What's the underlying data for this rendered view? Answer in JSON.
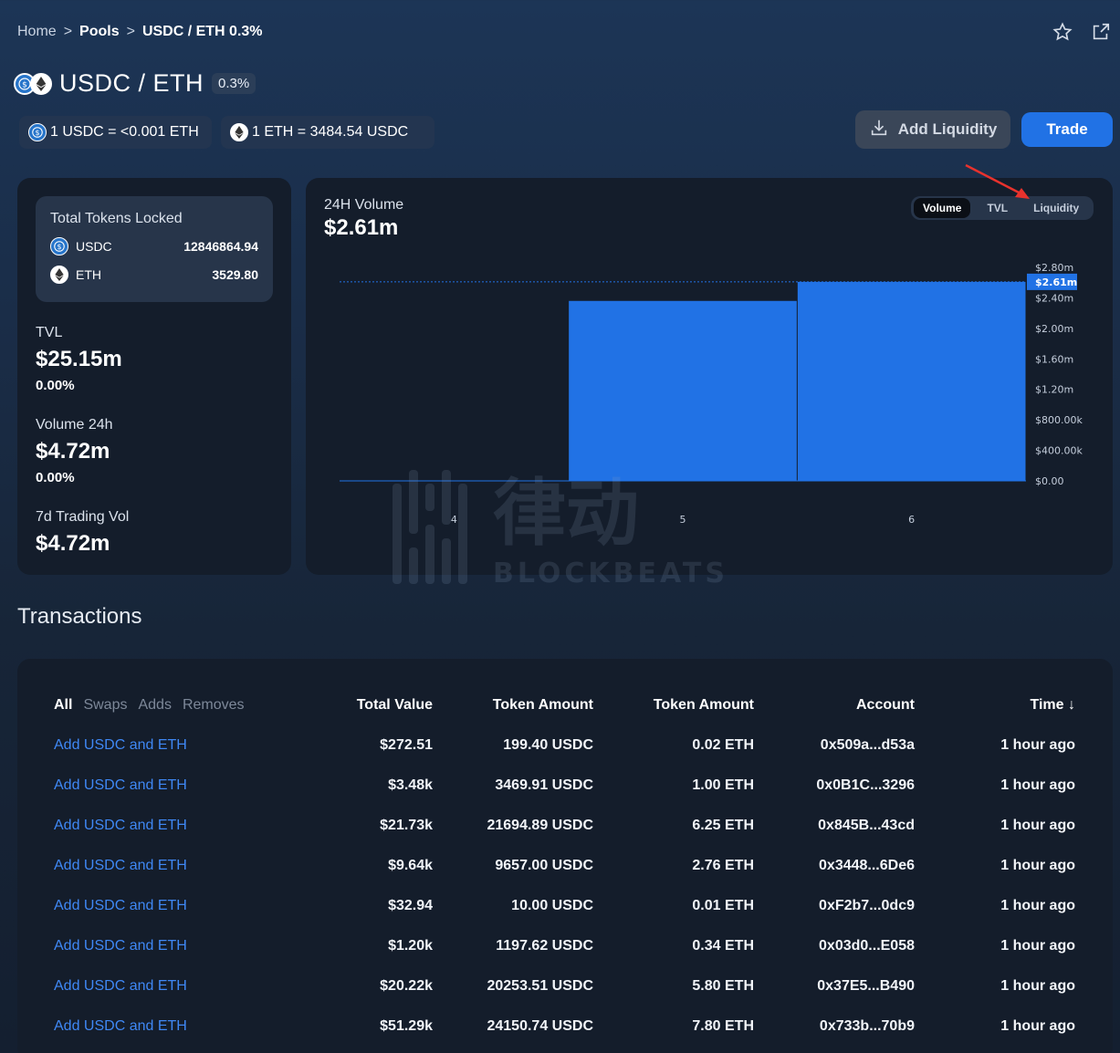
{
  "breadcrumb": {
    "home": "Home",
    "sep1": ">",
    "pools": "Pools",
    "sep2": ">",
    "current": "USDC / ETH 0.3%"
  },
  "pool": {
    "title": "USDC / ETH",
    "fee": "0.3%"
  },
  "prices": {
    "usdc_eth": "1 USDC = <0.001 ETH",
    "eth_usdc": "1 ETH = 3484.54 USDC"
  },
  "actions": {
    "add_liquidity": "Add Liquidity",
    "trade": "Trade"
  },
  "locked": {
    "title": "Total Tokens Locked",
    "tokens": [
      {
        "symbol": "USDC",
        "amount": "12846864.94"
      },
      {
        "symbol": "ETH",
        "amount": "3529.80"
      }
    ]
  },
  "stats": {
    "tvl": {
      "label": "TVL",
      "value": "$25.15m",
      "change": "0.00%"
    },
    "volume24h": {
      "label": "Volume 24h",
      "value": "$4.72m",
      "change": "0.00%"
    },
    "trading7d": {
      "label": "7d Trading Vol",
      "value": "$4.72m"
    }
  },
  "chart": {
    "title": "24H Volume",
    "value": "$2.61m",
    "tabs": [
      "Volume",
      "TVL",
      "Liquidity"
    ],
    "active_tab": "Volume"
  },
  "chart_data": {
    "type": "bar",
    "categories": [
      "4",
      "5",
      "6"
    ],
    "values": [
      0,
      2.36,
      2.61
    ],
    "current_label": "$2.61m",
    "ylim": [
      0,
      2.8
    ],
    "yticks": [
      {
        "v": 2.8,
        "label": "$2.80m"
      },
      {
        "v": 2.4,
        "label": "$2.40m"
      },
      {
        "v": 2.0,
        "label": "$2.00m"
      },
      {
        "v": 1.6,
        "label": "$1.60m"
      },
      {
        "v": 1.2,
        "label": "$1.20m"
      },
      {
        "v": 0.8,
        "label": "$800.00k"
      },
      {
        "v": 0.4,
        "label": "$400.00k"
      },
      {
        "v": 0,
        "label": "$0.00"
      }
    ],
    "bar_color": "#2172e5"
  },
  "transactions": {
    "heading": "Transactions",
    "filters": [
      "All",
      "Swaps",
      "Adds",
      "Removes"
    ],
    "columns": [
      "Total Value",
      "Token Amount",
      "Token Amount",
      "Account",
      "Time ↓"
    ],
    "rows": [
      {
        "desc": "Add USDC and ETH",
        "total": "$272.51",
        "amount1": "199.40 USDC",
        "amount2": "0.02 ETH",
        "account": "0x509a...d53a",
        "time": "1 hour ago"
      },
      {
        "desc": "Add USDC and ETH",
        "total": "$3.48k",
        "amount1": "3469.91 USDC",
        "amount2": "1.00 ETH",
        "account": "0x0B1C...3296",
        "time": "1 hour ago"
      },
      {
        "desc": "Add USDC and ETH",
        "total": "$21.73k",
        "amount1": "21694.89 USDC",
        "amount2": "6.25 ETH",
        "account": "0x845B...43cd",
        "time": "1 hour ago"
      },
      {
        "desc": "Add USDC and ETH",
        "total": "$9.64k",
        "amount1": "9657.00 USDC",
        "amount2": "2.76 ETH",
        "account": "0x3448...6De6",
        "time": "1 hour ago"
      },
      {
        "desc": "Add USDC and ETH",
        "total": "$32.94",
        "amount1": "10.00 USDC",
        "amount2": "0.01 ETH",
        "account": "0xF2b7...0dc9",
        "time": "1 hour ago"
      },
      {
        "desc": "Add USDC and ETH",
        "total": "$1.20k",
        "amount1": "1197.62 USDC",
        "amount2": "0.34 ETH",
        "account": "0x03d0...E058",
        "time": "1 hour ago"
      },
      {
        "desc": "Add USDC and ETH",
        "total": "$20.22k",
        "amount1": "20253.51 USDC",
        "amount2": "5.80 ETH",
        "account": "0x37E5...B490",
        "time": "1 hour ago"
      },
      {
        "desc": "Add USDC and ETH",
        "total": "$51.29k",
        "amount1": "24150.74 USDC",
        "amount2": "7.80 ETH",
        "account": "0x733b...70b9",
        "time": "1 hour ago"
      }
    ]
  },
  "watermark": {
    "cn": "律动",
    "en": "BLOCKBEATS"
  }
}
